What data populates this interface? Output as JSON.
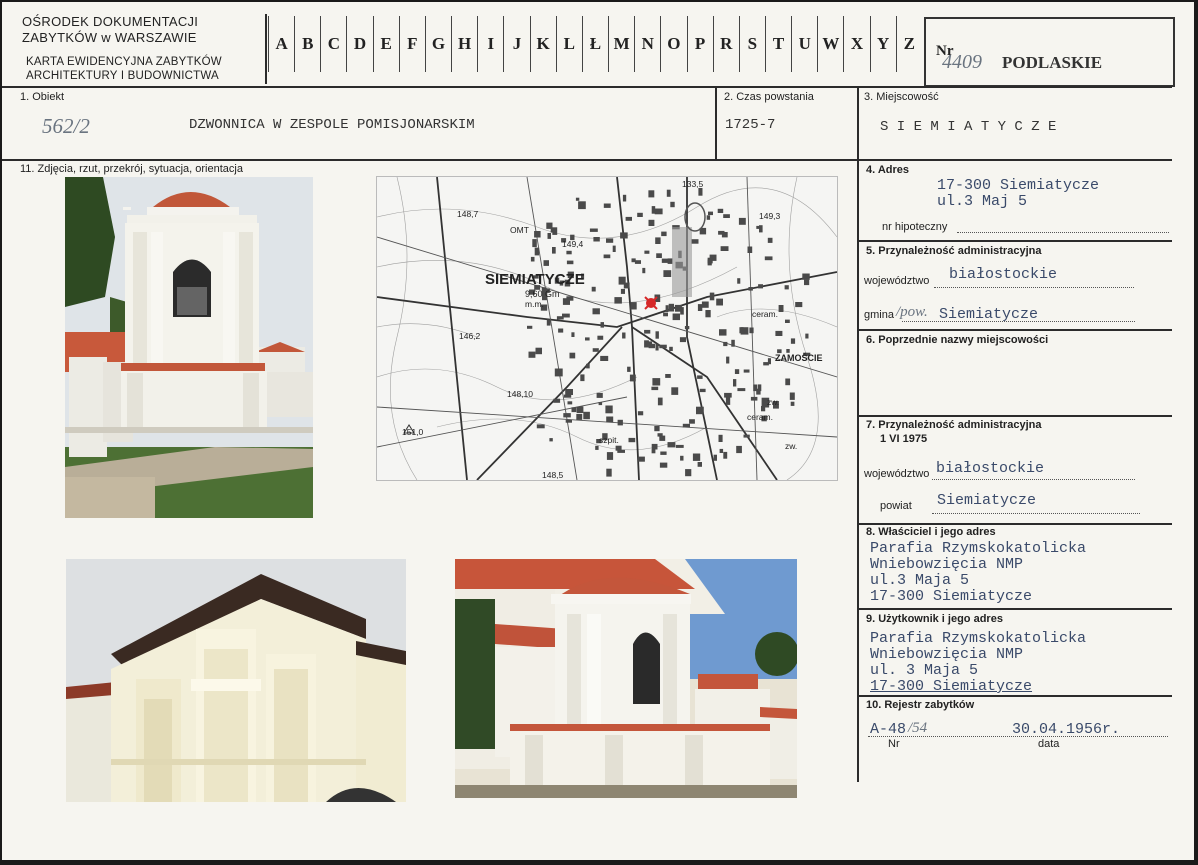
{
  "header": {
    "institution_line1": "OŚRODEK DOKUMENTACJI",
    "institution_line2": "ZABYTKÓW w WARSZAWIE",
    "card_type_line1": "KARTA EWIDENCYJNA ZABYTKÓW",
    "card_type_line2": "ARCHITEKTURY I BUDOWNICTWA",
    "letters": [
      "A",
      "B",
      "C",
      "D",
      "E",
      "F",
      "G",
      "H",
      "I",
      "J",
      "K",
      "L",
      "Ł",
      "M",
      "N",
      "O",
      "P",
      "R",
      "S",
      "T",
      "U",
      "W",
      "X",
      "Y",
      "Z"
    ],
    "nr_label": "Nr",
    "nr_value": "4409",
    "region": "PODLASKIE"
  },
  "fields": {
    "obiekt_label": "1. Obiekt",
    "obiekt_number": "562/2",
    "obiekt_value": "DZWONNICA W ZESPOLE POMISJONARSKIM",
    "czas_label": "2. Czas powstania",
    "czas_value": "1725-7",
    "miejscowosc_label": "3. Miejscowość",
    "miejscowosc_value": "S I E M I A T Y C Z E",
    "photos_label": "11. Zdjęcia, rzut, przekrój, sytuacja, orientacja",
    "adres_label": "4. Adres",
    "adres_line1": "17-300 Siemiatycze",
    "adres_line2": "ul.3 Maj 5",
    "hipoteczny_label": "nr hipoteczny",
    "przynal_label": "5. Przynależność administracyjna",
    "wojewodztwo_label": "województwo",
    "wojewodztwo_value": "białostockie",
    "gmina_label": "gmina",
    "gmina_hand": "/pow.",
    "gmina_value": "Siemiatycze",
    "poprzednie_label": "6. Poprzednie nazwy miejscowości",
    "przynal1975_label": "7. Przynależność administracyjna",
    "przynal1975_date": "1 VI 1975",
    "wojewodztwo2_label": "województwo",
    "wojewodztwo2_value": "białostockie",
    "powiat_label": "powiat",
    "powiat_value": "Siemiatycze",
    "wlasciciel_label": "8. Właściciel i jego adres",
    "wlasciciel_lines": [
      "Parafia Rzymskokatolicka",
      "Wniebowzięcia NMP",
      "ul.3 Maja 5",
      "17-300 Siemiatycze"
    ],
    "uzytkownik_label": "9. Użytkownik i jego adres",
    "uzytkownik_lines": [
      "Parafia Rzymskokatolicka",
      "Wniebowzięcia NMP",
      "ul. 3 Maja 5",
      "17-300 Siemiatycze"
    ],
    "rejestr_label": "10. Rejestr zabytków",
    "rejestr_nr": "A-48",
    "rejestr_nr_hand": "/54",
    "rejestr_data": "30.04.1956r.",
    "nr_sub": "Nr",
    "data_sub": "data"
  },
  "map": {
    "town": "SIEMIATYCZE",
    "station": "9,60 Gm",
    "district": "ZAMOŚCIE",
    "labels": [
      "148,7",
      "133,5",
      "149,3",
      "149,4",
      "146,2",
      "148,10",
      "151,0",
      "148,5",
      "OMT",
      "m.m.",
      "ceram.",
      "ceram.",
      "szpit.",
      "zw.",
      "zw."
    ]
  }
}
